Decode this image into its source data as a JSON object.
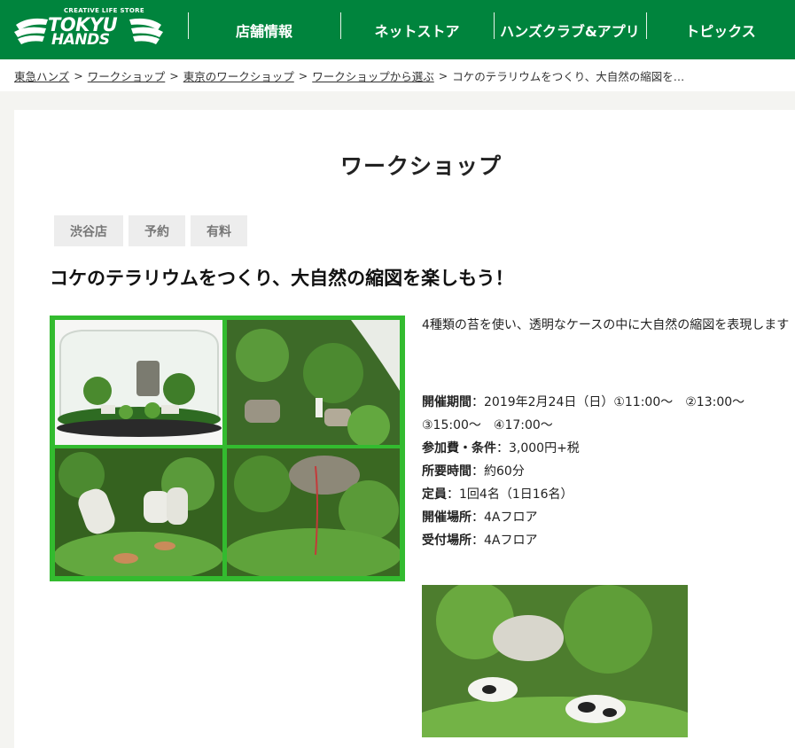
{
  "header": {
    "logo_small": "CREATIVE LIFE STORE",
    "logo_line1": "TOKYU",
    "logo_line2": "HANDS",
    "nav": [
      "店舗情報",
      "ネットストア",
      "ハンズクラブ&アプリ",
      "トピックス"
    ]
  },
  "breadcrumb": {
    "items": [
      "東急ハンズ",
      "ワークショップ",
      "東京のワークショップ",
      "ワークショップから選ぶ"
    ],
    "separator": ">",
    "current": "コケのテラリウムをつくり、大自然の縮図を…"
  },
  "page_title": "ワークショップ",
  "tags": [
    "渋谷店",
    "予約",
    "有料"
  ],
  "headline": "コケのテラリウムをつくり、大自然の縮図を楽しもう！",
  "description": "4種類の苔を使い、透明なケースの中に大自然の縮図を表現します",
  "details": [
    {
      "label": "開催期間",
      "sep": "：",
      "value": "2019年2月24日（日）①11:00～　②13:00～　③15:00～　④17:00～"
    },
    {
      "label": "参加費・条件",
      "sep": "：",
      "value": "3,000円+税"
    },
    {
      "label": "所要時間",
      "sep": "：",
      "value": "約60分"
    },
    {
      "label": "定員",
      "sep": "：",
      "value": "1回4名（1日16名）"
    },
    {
      "label": "開催場所",
      "sep": "：",
      "value": "4Aフロア"
    },
    {
      "label": "受付場所",
      "sep": "：",
      "value": "4Aフロア"
    }
  ],
  "colors": {
    "header_green": "#00843d",
    "photo_frame_green": "#33bb2f",
    "tag_bg": "#ededed"
  }
}
